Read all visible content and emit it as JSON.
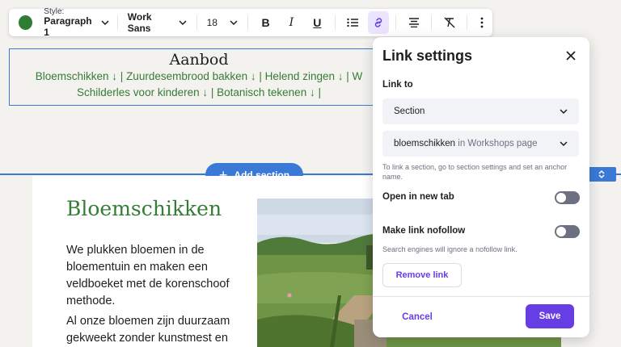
{
  "colors": {
    "accent": "#673de6",
    "brand_green": "#357c36",
    "selection_blue": "#3a7ad6",
    "swatch": "#2e7d32"
  },
  "toolbar": {
    "color_swatch_icon": "color-circle-icon",
    "style_label": "Style:",
    "style_value": "Paragraph 1",
    "font_value": "Work Sans",
    "size_value": "18",
    "bold_label": "B",
    "italic_label": "I",
    "underline_label": "U"
  },
  "heading_block": {
    "title": "Aanbod",
    "links_line1": "Bloemschikken ↓ | Zuurdesembrood bakken ↓ | Helend zingen ↓ | W",
    "links_line2": "Schilderles voor kinderen ↓ | Botanisch tekenen ↓ |"
  },
  "add_section": {
    "label": "Add section"
  },
  "content": {
    "title": "Bloemschikken",
    "para1": "We plukken bloemen in de bloementuin en maken een veldboeket met de korenschoof methode.",
    "para2": "Al onze bloemen zijn duurzaam gekweekt zonder kunstmest en"
  },
  "modal": {
    "title": "Link settings",
    "link_to_label": "Link to",
    "select_type": "Section",
    "select_target_name": "bloemschikken",
    "select_target_suffix": "in Workshops page",
    "hint_section": "To link a section, go to section settings and set an anchor name.",
    "open_new_tab_label": "Open in new tab",
    "open_new_tab_on": false,
    "nofollow_label": "Make link nofollow",
    "nofollow_on": false,
    "hint_nofollow": "Search engines will ignore a nofollow link.",
    "remove_link_label": "Remove link",
    "cancel_label": "Cancel",
    "save_label": "Save"
  }
}
